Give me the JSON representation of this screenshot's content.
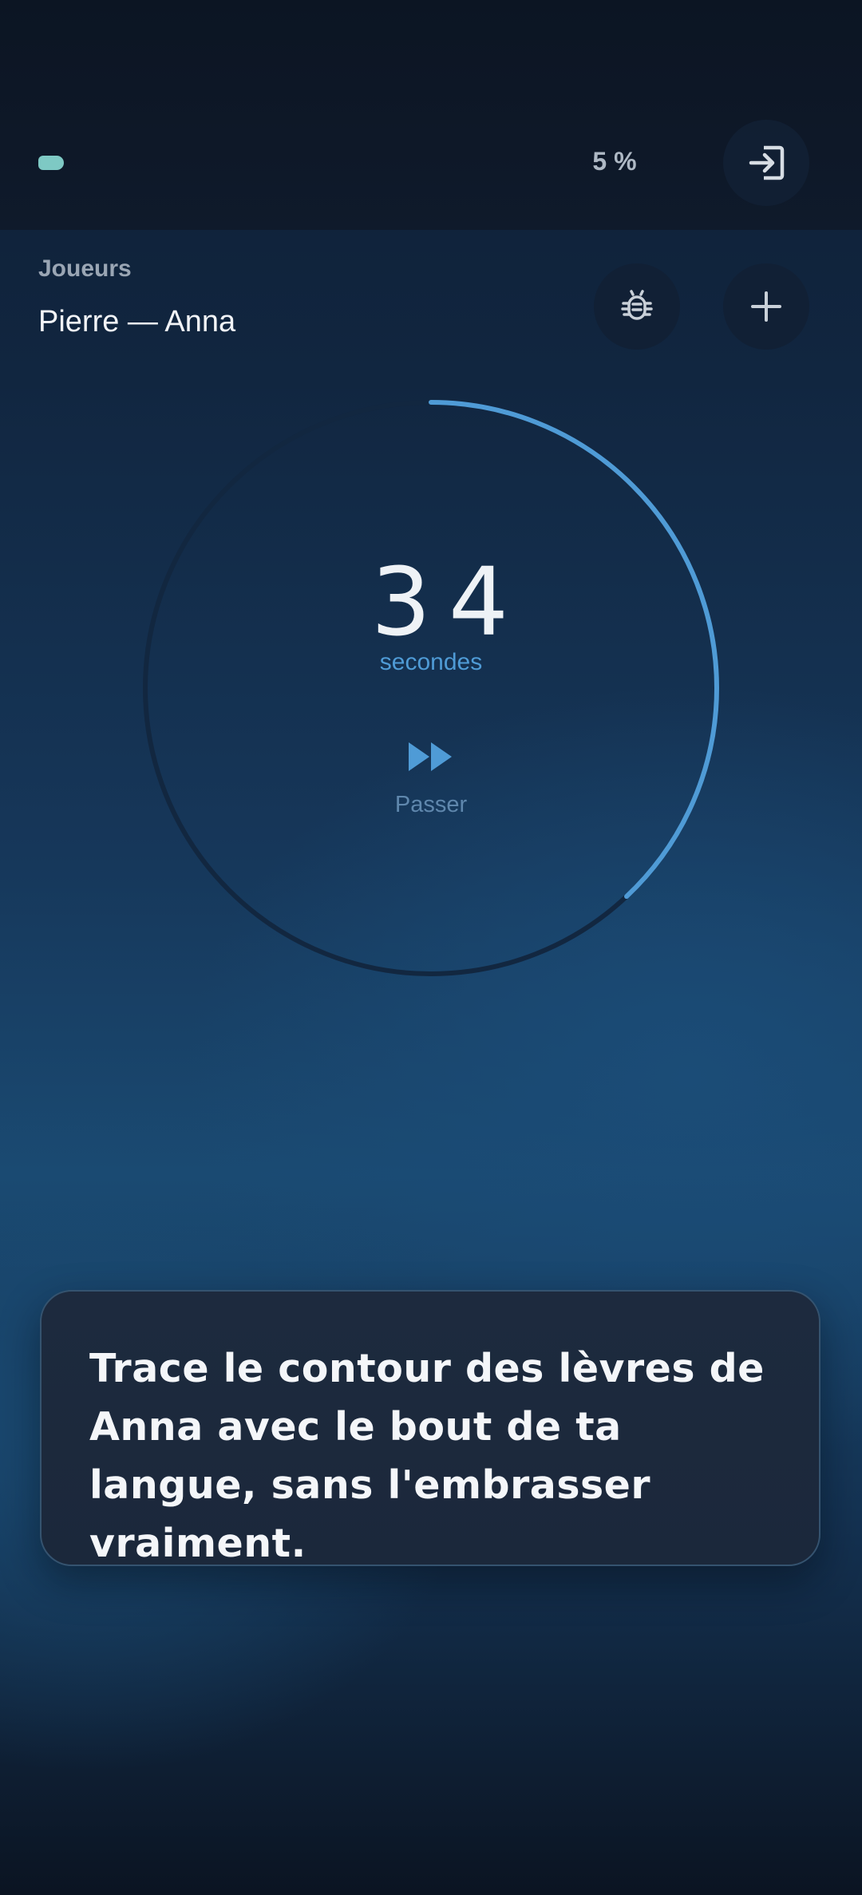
{
  "header": {
    "progress_percent": 5,
    "progress_label": "5 %",
    "exit_icon": "exit-icon",
    "accent_color": "#7ec9c4"
  },
  "players": {
    "label": "Joueurs",
    "names": "Pierre — Anna",
    "bug_icon": "bug-icon",
    "add_icon": "plus-icon"
  },
  "timer": {
    "seconds": "34",
    "unit": "secondes",
    "skip_label": "Passer",
    "skip_icon": "fast-forward-icon",
    "remaining_fraction": 0.38,
    "ring_color": "#4f9bd6"
  },
  "challenge": {
    "text": "Trace le contour des lèvres de Anna avec le bout de ta langue, sans l'embrasser vraiment."
  }
}
